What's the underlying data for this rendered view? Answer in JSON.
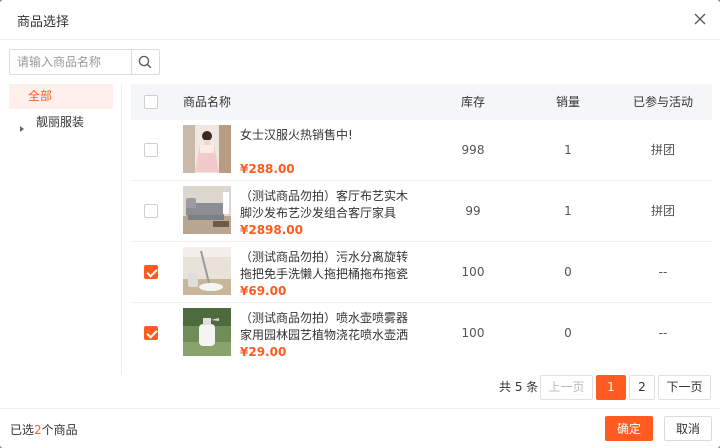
{
  "dialog": {
    "title": "商品选择"
  },
  "search": {
    "placeholder": "请输入商品名称"
  },
  "tree": {
    "all": "全部",
    "items": [
      {
        "label": "靓丽服装"
      }
    ]
  },
  "table": {
    "headers": {
      "name": "商品名称",
      "stock": "库存",
      "sales": "销量",
      "activity": "已参与活动"
    },
    "rows": [
      {
        "name": "女士汉服火热销售中!",
        "price": "¥288.00",
        "stock": "998",
        "sales": "1",
        "activity": "拼团",
        "checked": false
      },
      {
        "name": "（测试商品勿拍）客厅布艺实木脚沙发布艺沙发组合客厅家具",
        "price": "¥2898.00",
        "stock": "99",
        "sales": "1",
        "activity": "拼团",
        "checked": false
      },
      {
        "name": "（测试商品勿拍）污水分离旋转拖把免手洗懒人拖把桶拖布拖瓷砖…",
        "price": "¥69.00",
        "stock": "100",
        "sales": "0",
        "activity": "--",
        "checked": true
      },
      {
        "name": "（测试商品勿拍）喷水壶喷雾器 家用园林园艺植物浇花喷水壶洒水…",
        "price": "¥29.00",
        "stock": "100",
        "sales": "0",
        "activity": "--",
        "checked": true
      }
    ]
  },
  "pagination": {
    "total": "共 5 条",
    "prev": "上一页",
    "pages": [
      "1",
      "2"
    ],
    "next": "下一页",
    "current": "1"
  },
  "footer": {
    "selected_prefix": "已选",
    "selected_count": "2",
    "selected_suffix": "个商品",
    "confirm": "确定",
    "cancel": "取消"
  },
  "colors": {
    "accent": "#ff5a1f",
    "accent_bg": "#fdf0ea"
  },
  "icons": {
    "close": "close-icon",
    "search": "search-icon",
    "expand": "caret-right-icon"
  }
}
